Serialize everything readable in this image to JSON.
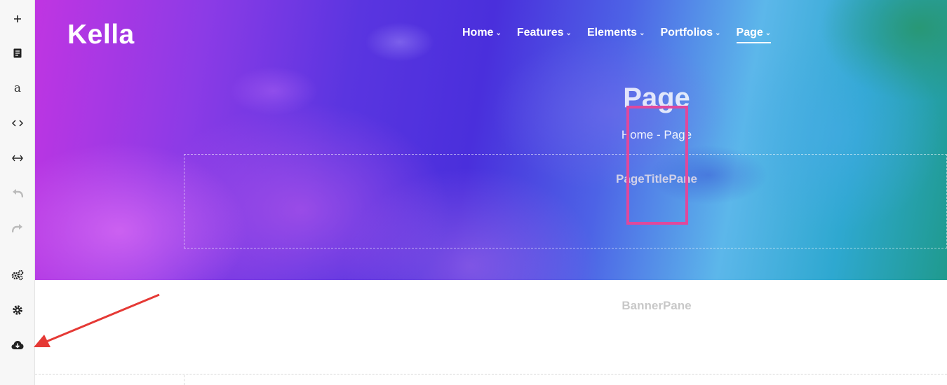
{
  "site": {
    "logo_text": "Kella"
  },
  "nav": {
    "items": [
      {
        "label": "Home",
        "active": false
      },
      {
        "label": "Features",
        "active": false
      },
      {
        "label": "Elements",
        "active": false
      },
      {
        "label": "Portfolios",
        "active": false
      },
      {
        "label": "Page",
        "active": true
      }
    ],
    "chevron": "⌄"
  },
  "hero": {
    "title": "Page",
    "breadcrumb": "Home - Page",
    "pane_label": "PageTitlePane"
  },
  "banner": {
    "pane_label": "BannerPane"
  },
  "toolbar": {
    "items": [
      {
        "icon": "plus-icon"
      },
      {
        "icon": "document-icon"
      },
      {
        "icon": "text-a-icon",
        "glyph": "a"
      },
      {
        "icon": "code-icon"
      },
      {
        "icon": "expand-horizontal-icon"
      },
      {
        "icon": "undo-icon",
        "disabled": true
      },
      {
        "icon": "redo-icon",
        "disabled": true
      },
      {
        "icon": "gears-icon"
      },
      {
        "icon": "settings-gear-icon"
      },
      {
        "icon": "cloud-download-icon"
      }
    ]
  },
  "colors": {
    "highlight": "#e0489c",
    "annotation_arrow": "#e53935",
    "pane_label_hero": "#d0d0e8",
    "pane_label_banner": "#c8c8c8"
  }
}
